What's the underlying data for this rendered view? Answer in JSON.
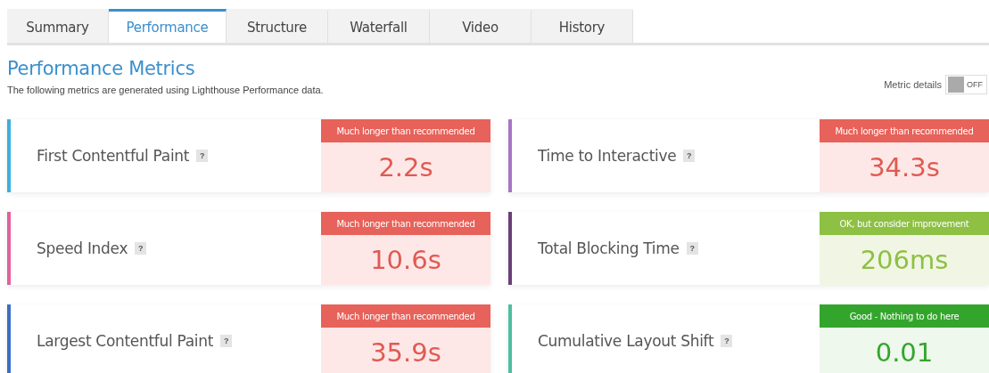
{
  "tabs": [
    {
      "label": "Summary",
      "selected": false
    },
    {
      "label": "Performance",
      "selected": true
    },
    {
      "label": "Structure",
      "selected": false
    },
    {
      "label": "Waterfall",
      "selected": false
    },
    {
      "label": "Video",
      "selected": false
    },
    {
      "label": "History",
      "selected": false
    }
  ],
  "title": "Performance Metrics",
  "description": "The following metrics are generated using Lighthouse Performance data.",
  "metric_details_toggle": {
    "label": "Metric details",
    "state_text": "OFF",
    "on": false
  },
  "metrics": [
    {
      "name": "First Contentful Paint",
      "help": "?",
      "color": "#3ab0dc",
      "kind": "poor",
      "verdict": "Much longer than recommended",
      "value": "2.2s"
    },
    {
      "name": "Time to Interactive",
      "help": "?",
      "color": "#a874c8",
      "kind": "poor",
      "verdict": "Much longer than recommended",
      "value": "34.3s"
    },
    {
      "name": "Speed Index",
      "help": "?",
      "color": "#e2609e",
      "kind": "poor",
      "verdict": "Much longer than recommended",
      "value": "10.6s"
    },
    {
      "name": "Total Blocking Time",
      "help": "?",
      "color": "#6a3f78",
      "kind": "average",
      "verdict": "OK, but consider improvement",
      "value": "206ms"
    },
    {
      "name": "Largest Contentful Paint",
      "help": "?",
      "color": "#3a6fc8",
      "kind": "poor",
      "verdict": "Much longer than recommended",
      "value": "35.9s"
    },
    {
      "name": "Cumulative Layout Shift",
      "help": "?",
      "color": "#4dbfa0",
      "kind": "good",
      "verdict": "Good - Nothing to do here",
      "value": "0.01"
    }
  ]
}
